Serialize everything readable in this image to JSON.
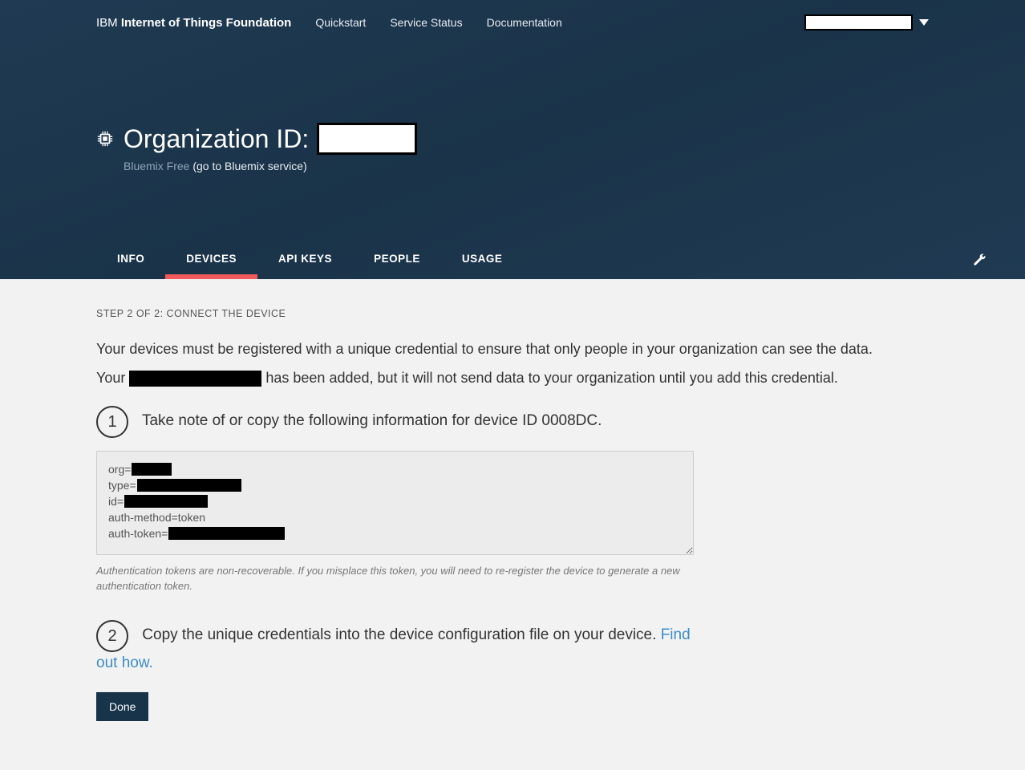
{
  "brand": {
    "light": "IBM ",
    "bold": "Internet of Things Foundation"
  },
  "nav": {
    "quickstart": "Quickstart",
    "service_status": "Service Status",
    "documentation": "Documentation"
  },
  "org": {
    "title_prefix": "Organization ID:",
    "plan": "Bluemix Free",
    "plan_link": " (go to Bluemix service)"
  },
  "tabs": {
    "info": "INFO",
    "devices": "DEVICES",
    "api_keys": "API KEYS",
    "people": "PEOPLE",
    "usage": "USAGE"
  },
  "content": {
    "step_heading": "STEP 2 OF 2: CONNECT THE DEVICE",
    "desc_line1": "Your devices must be registered with a unique credential to ensure that only people in your organization can see the data.",
    "desc_line2_prefix": "Your ",
    "desc_line2_suffix": " has been added, but it will not send data to your organization until you add this credential.",
    "step1_text_a": "Take note of or copy the following information for device ID 0008DC",
    "step1_text_b": ".",
    "cred": {
      "org_label": "org=",
      "type_label": "type=",
      "id_label": "id=",
      "auth_method": "auth-method=token",
      "auth_token_label": "auth-token="
    },
    "note": "Authentication tokens are non-recoverable. If you misplace this token, you will need to re-register the device to generate a new authentication token.",
    "step2_text": "Copy the unique credentials into the device configuration file on your device. ",
    "step2_link": "Find out how.",
    "done": "Done",
    "step1_num": "1",
    "step2_num": "2"
  }
}
